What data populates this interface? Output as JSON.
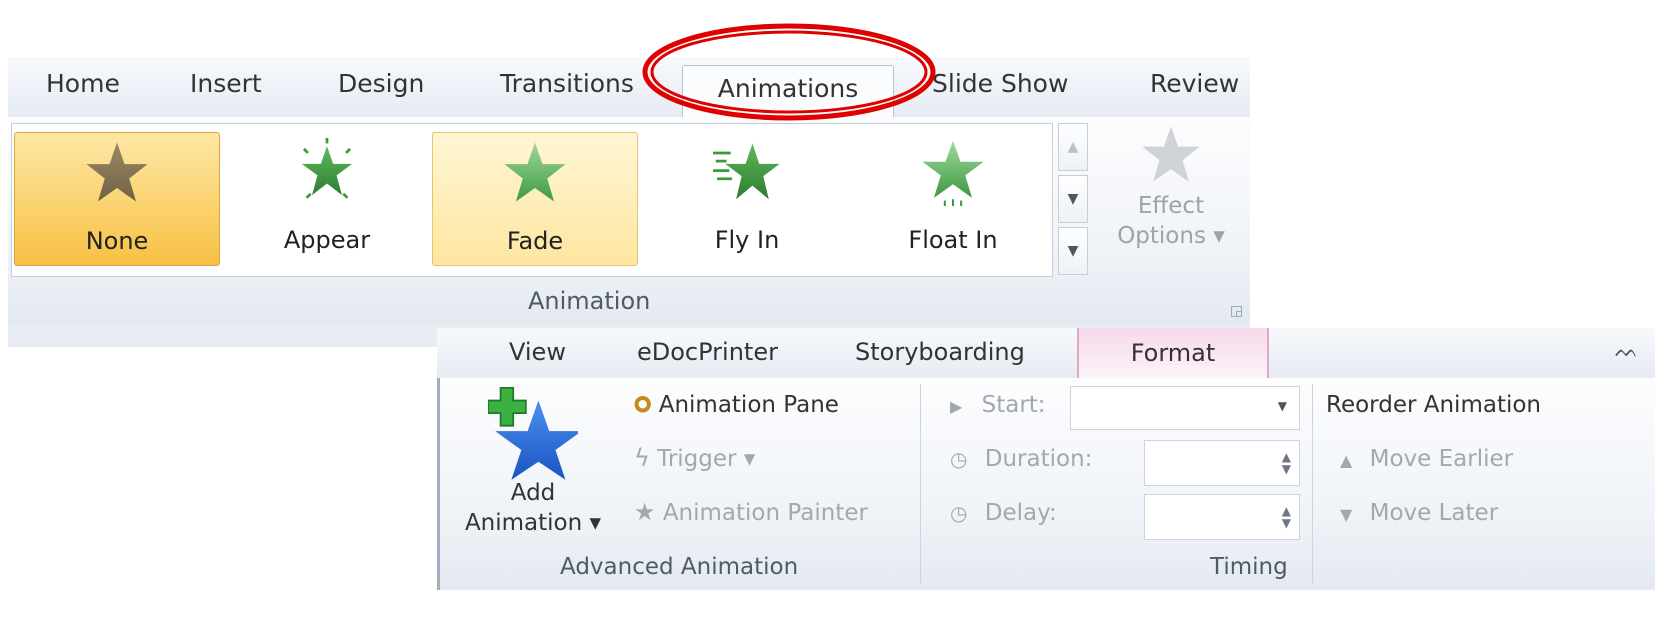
{
  "top_ribbon": {
    "tabs": [
      "Home",
      "Insert",
      "Design",
      "Transitions",
      "Animations",
      "Slide Show",
      "Review"
    ],
    "active_tab": "Animations",
    "highlight_color": "#e00000",
    "gallery": [
      {
        "label": "None",
        "icon": "star-none-icon"
      },
      {
        "label": "Appear",
        "icon": "star-appear-icon"
      },
      {
        "label": "Fade",
        "icon": "star-fade-icon"
      },
      {
        "label": "Fly In",
        "icon": "star-fly-in-icon"
      },
      {
        "label": "Float In",
        "icon": "star-float-in-icon"
      }
    ],
    "effect_options": {
      "line1": "Effect",
      "line2": "Options ▾"
    },
    "group_label": "Animation"
  },
  "bottom_ribbon": {
    "tabs": [
      "View",
      "eDocPrinter",
      "Storyboarding",
      "Format"
    ],
    "advanced": {
      "add_animation_line1": "Add",
      "add_animation_line2": "Animation ▾",
      "animation_pane": "Animation Pane",
      "trigger": "Trigger ▾",
      "animation_painter": "Animation Painter",
      "group_label": "Advanced Animation"
    },
    "timing": {
      "start_label": "Start:",
      "duration_label": "Duration:",
      "delay_label": "Delay:",
      "group_label": "Timing"
    },
    "reorder": {
      "title": "Reorder Animation",
      "move_earlier": "Move Earlier",
      "move_later": "Move Later"
    }
  }
}
